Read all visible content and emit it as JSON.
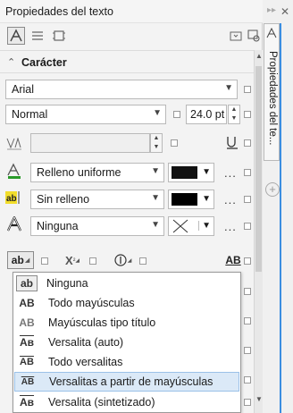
{
  "panel": {
    "title": "Propiedades del texto",
    "side_tab_label": "Propiedades del te..."
  },
  "section": {
    "label": "Carácter"
  },
  "font": {
    "family": "Arial",
    "style": "Normal",
    "size": "24.0 pt"
  },
  "fill": {
    "type": "Relleno uniforme",
    "color": "#111111",
    "more": "..."
  },
  "background_fill": {
    "type": "Sin relleno",
    "color": "#000000",
    "more": "..."
  },
  "outline": {
    "value": "Ninguna",
    "more": "..."
  },
  "case_dropdown": {
    "items": [
      {
        "icon": "ab",
        "label": "Ninguna"
      },
      {
        "icon": "AB",
        "label": "Todo mayúsculas"
      },
      {
        "icon": "AB",
        "label": "Mayúsculas tipo título"
      },
      {
        "icon": "Aв",
        "label": "Versalita (auto)"
      },
      {
        "icon": "AB",
        "label": "Todo versalitas"
      },
      {
        "icon": "AB",
        "label": "Versalitas a partir de mayúsculas"
      },
      {
        "icon": "Aв",
        "label": "Versalita (sintetizado)"
      }
    ],
    "highlighted_index": 5
  },
  "colors": {
    "accent": "#3a8de0",
    "highlight": "#dbe9f7"
  }
}
